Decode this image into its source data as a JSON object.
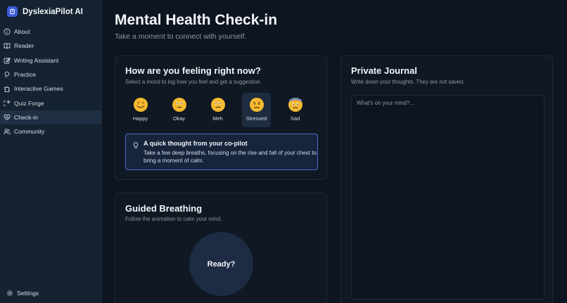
{
  "app": {
    "name": "DyslexiaPilot AI"
  },
  "sidebar": {
    "items": [
      {
        "label": "About",
        "icon": "info-icon"
      },
      {
        "label": "Reader",
        "icon": "book-icon"
      },
      {
        "label": "Writing Assistant",
        "icon": "edit-icon"
      },
      {
        "label": "Practice",
        "icon": "pin-icon"
      },
      {
        "label": "Interactive Games",
        "icon": "puzzle-icon"
      },
      {
        "label": "Quiz Forge",
        "icon": "sparkle-icon"
      },
      {
        "label": "Check-in",
        "icon": "heart-icon",
        "active": true
      },
      {
        "label": "Community",
        "icon": "users-icon"
      }
    ],
    "settings_label": "Settings"
  },
  "page": {
    "title": "Mental Health Check-in",
    "subtitle": "Take a moment to connect with yourself."
  },
  "mood_card": {
    "title": "How are you feeling right now?",
    "subtitle": "Select a mood to log how you feel and get a suggestion.",
    "moods": [
      {
        "label": "Happy",
        "icon": "happy-face-icon"
      },
      {
        "label": "Okay",
        "icon": "okay-face-icon"
      },
      {
        "label": "Meh",
        "icon": "meh-face-icon"
      },
      {
        "label": "Stressed",
        "icon": "stressed-face-icon",
        "selected": true
      },
      {
        "label": "Sad",
        "icon": "sad-face-icon"
      }
    ],
    "tip": {
      "title": "A quick thought from your co-pilot",
      "text": "Take a few deep breaths, focusing on the rise and fall of your chest to bring a moment of calm."
    }
  },
  "breathing_card": {
    "title": "Guided Breathing",
    "subtitle": "Follow the animation to calm your mind.",
    "circle_label": "Ready?"
  },
  "journal_card": {
    "title": "Private Journal",
    "subtitle": "Write down your thoughts. They are not saved.",
    "placeholder": "What's on your mind?..."
  },
  "colors": {
    "accent": "#4a6fd1",
    "background": "#0d1520",
    "sidebar": "#152231",
    "emoji_yellow": "#f5b92e"
  }
}
